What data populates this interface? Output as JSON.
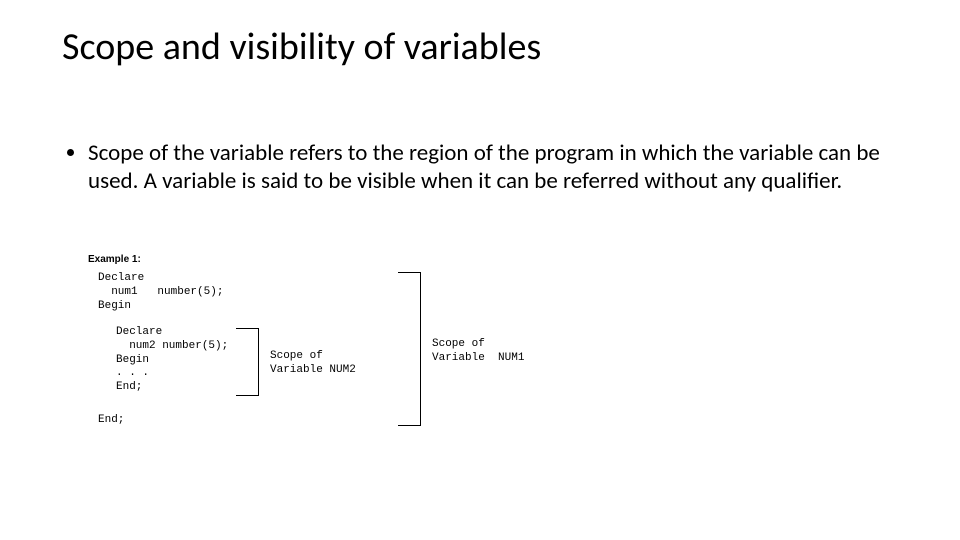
{
  "title": "Scope and visibility of variables",
  "bullet": "Scope of the variable refers to the region of the program in which the variable can be used. A variable is said to be visible when it can be referred without any qualifier.",
  "diagram": {
    "example_label": "Example 1:",
    "code_outer": "Declare\n  num1   number(5);\nBegin",
    "code_inner": "Declare\n  num2 number(5);\nBegin\n. . .\nEnd;",
    "code_end": "End;",
    "scope_num2": "Scope of\nVariable NUM2",
    "scope_num1": "Scope of\nVariable  NUM1"
  }
}
